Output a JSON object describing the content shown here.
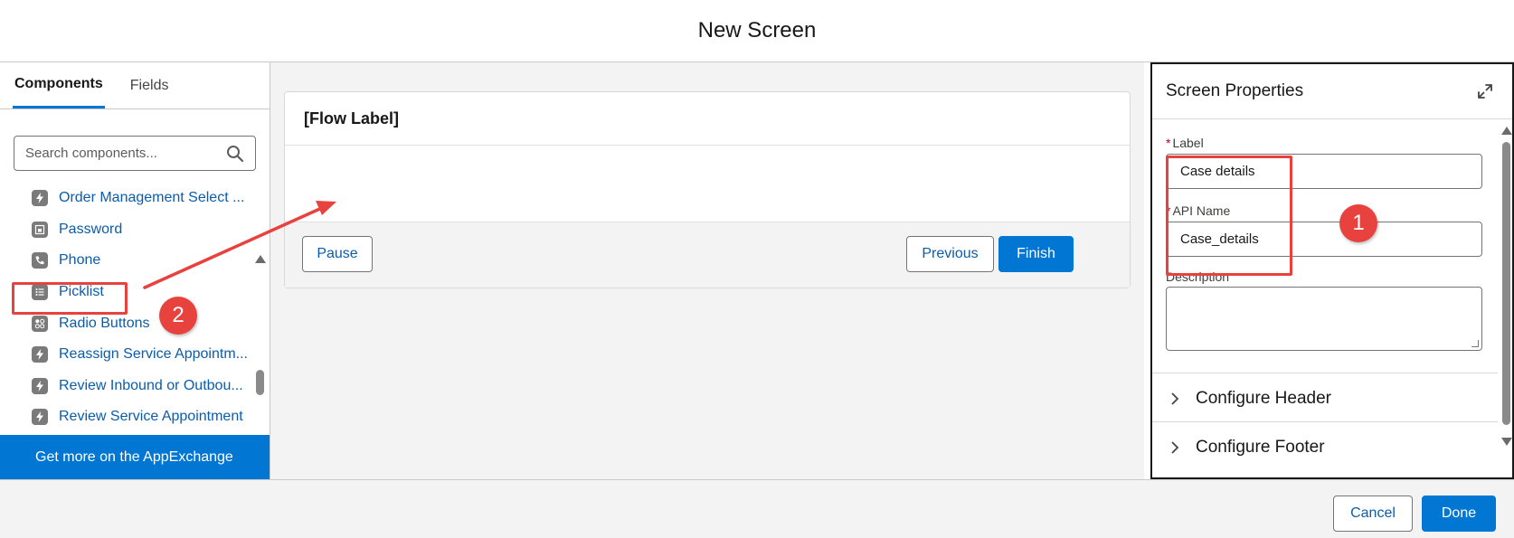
{
  "modal": {
    "title": "New Screen"
  },
  "left_panel": {
    "tabs": [
      {
        "label": "Components",
        "active": true
      },
      {
        "label": "Fields",
        "active": false
      }
    ],
    "search": {
      "placeholder": "Search components..."
    },
    "components": [
      {
        "label": "Order Management Select ...",
        "icon": "lightning-icon"
      },
      {
        "label": "Password",
        "icon": "password-icon"
      },
      {
        "label": "Phone",
        "icon": "phone-icon"
      },
      {
        "label": "Picklist",
        "icon": "picklist-icon"
      },
      {
        "label": "Radio Buttons",
        "icon": "radio-buttons-icon"
      },
      {
        "label": "Reassign Service Appointm...",
        "icon": "lightning-icon"
      },
      {
        "label": "Review Inbound or Outbou...",
        "icon": "lightning-icon"
      },
      {
        "label": "Review Service Appointment",
        "icon": "lightning-icon"
      }
    ],
    "appexchange_link": "Get more on the AppExchange"
  },
  "canvas": {
    "flow_label": "[Flow Label]",
    "pause_label": "Pause",
    "previous_label": "Previous",
    "finish_label": "Finish"
  },
  "properties": {
    "title": "Screen Properties",
    "label_field": {
      "label": "Label",
      "value": "Case details",
      "required": true
    },
    "api_name_field": {
      "label": "API Name",
      "value": "Case_details",
      "required": true
    },
    "description_field": {
      "label": "Description",
      "value": ""
    },
    "sections": [
      {
        "label": "Configure Header"
      },
      {
        "label": "Configure Footer"
      }
    ]
  },
  "footer": {
    "cancel_label": "Cancel",
    "done_label": "Done"
  },
  "annotations": {
    "step1": "1",
    "step2": "2"
  },
  "colors": {
    "brand": "#0176d3",
    "link": "#0b5cab",
    "annotation": "#e8423f"
  }
}
